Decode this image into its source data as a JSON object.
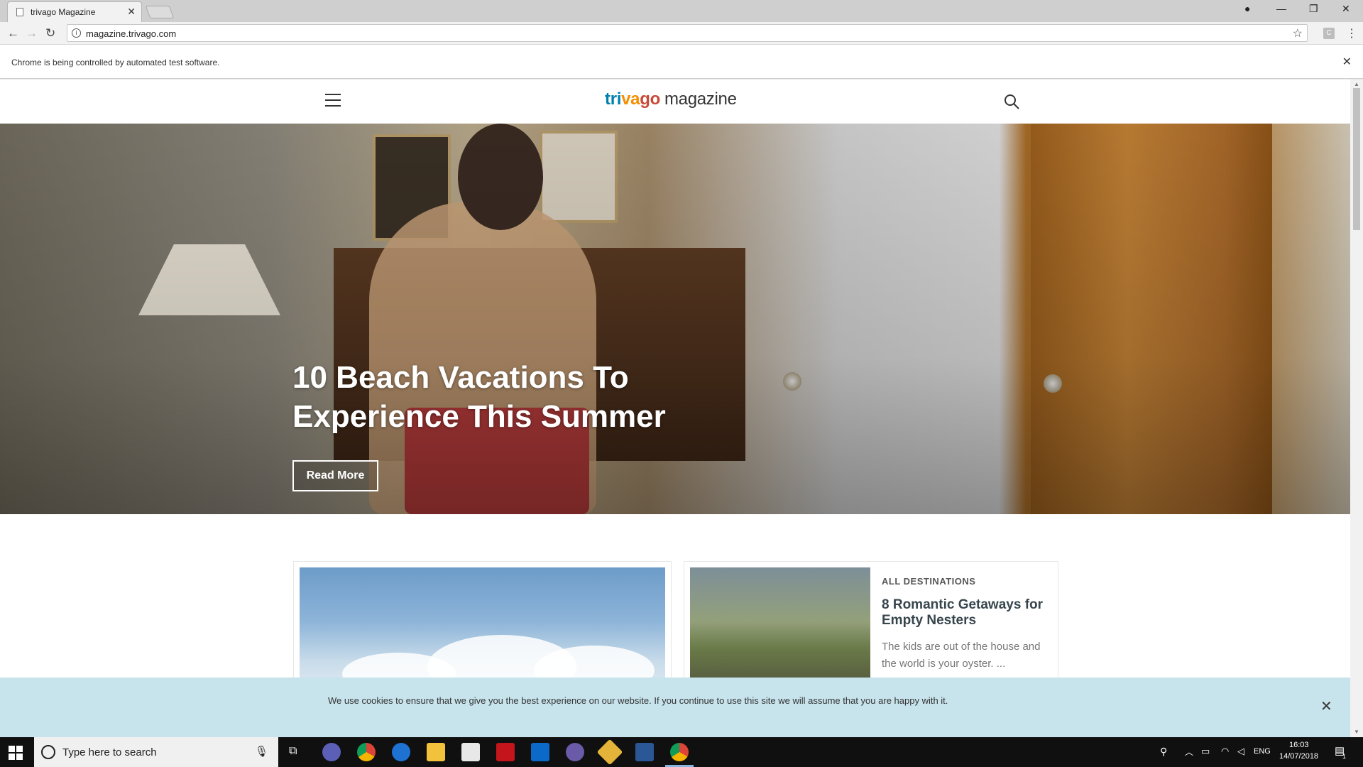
{
  "browser": {
    "tab_title": "trivago Magazine",
    "tab_close": "✕",
    "url": "magazine.trivago.com",
    "infobar_text": "Chrome is being controlled by automated test software.",
    "infobar_close": "✕",
    "ext_label": "C"
  },
  "site": {
    "logo": {
      "tri": "tri",
      "va": "va",
      "go": "go",
      "magazine": "magazine"
    },
    "hero": {
      "title": "10 Beach Vacations To Experience This Summer",
      "button": "Read More"
    },
    "cards": [
      {
        "category": "ALL DESTINATIONS",
        "title": "8 Romantic Getaways for Empty Nesters",
        "description": "The kids are out of the house and the world is your oyster. ..."
      }
    ],
    "cookie": {
      "text": "We use cookies to ensure that we give you the best experience on our website. If you continue to use this site we will assume that you are happy with it.",
      "close": "✕"
    }
  },
  "taskbar": {
    "search_placeholder": "Type here to search",
    "language": "ENG",
    "time": "16:03",
    "date": "14/07/2018",
    "notification_count": "1"
  }
}
